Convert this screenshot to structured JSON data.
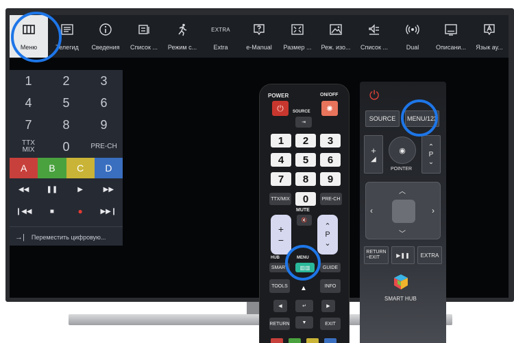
{
  "menu": {
    "items": [
      {
        "label": "Меню",
        "icon": "menu-grid-icon"
      },
      {
        "label": "Телегид",
        "icon": "guide-icon"
      },
      {
        "label": "Сведения",
        "icon": "info-icon"
      },
      {
        "label": "Список ...",
        "icon": "channel-list-icon"
      },
      {
        "label": "Режим с...",
        "icon": "sports-mode-icon"
      },
      {
        "label": "Extra",
        "icon": "extra-icon",
        "icon_text": "EXTRA"
      },
      {
        "label": "e-Manual",
        "icon": "emanual-icon"
      },
      {
        "label": "Размер ...",
        "icon": "picture-size-icon"
      },
      {
        "label": "Реж. изо...",
        "icon": "picture-mode-icon"
      },
      {
        "label": "Список ...",
        "icon": "sound-list-icon"
      },
      {
        "label": "Dual",
        "icon": "dual-icon"
      },
      {
        "label": "Описани...",
        "icon": "description-icon"
      },
      {
        "label": "Язык ау...",
        "icon": "audio-language-icon"
      }
    ]
  },
  "virtual_remote": {
    "numbers": [
      "1",
      "2",
      "3",
      "4",
      "5",
      "6",
      "7",
      "8",
      "9"
    ],
    "ttx": "TTX\nMIX",
    "zero": "0",
    "prech": "PRE-CH",
    "colors": [
      {
        "label": "A",
        "color": "#c8403b"
      },
      {
        "label": "B",
        "color": "#4aa23f"
      },
      {
        "label": "C",
        "color": "#c9b437"
      },
      {
        "label": "D",
        "color": "#3a6fc0"
      }
    ],
    "media_row1": [
      "◀◀",
      "❚❚",
      "▶",
      "▶▶"
    ],
    "media_row2": [
      "❙◀◀",
      "■",
      "●",
      "▶▶❙"
    ],
    "bottom_arrow": "→|",
    "bottom_text": "Переместить цифровую..."
  },
  "remote1": {
    "power": "POWER",
    "onoff": "ON/OFF",
    "source": "SOURCE",
    "digits": [
      "1",
      "2",
      "3",
      "4",
      "5",
      "6",
      "7",
      "8",
      "9",
      "0"
    ],
    "ttxmix": "TTX/MIX",
    "prech": "PRE-CH",
    "mute": "MUTE",
    "hub": "HUB",
    "menu": "MENU",
    "smart": "SMART",
    "guide": "GUIDE",
    "tools": "TOOLS",
    "info": "INFO",
    "return": "RETURN",
    "exit": "EXIT",
    "p": "P"
  },
  "remote2": {
    "source": "SOURCE",
    "menu": "MENU/123",
    "pointer": "POINTER",
    "p": "P",
    "return": "RETURN\n−EXIT",
    "playpause": "▶❚❚",
    "extra": "EXTRA",
    "smart_hub": "SMART HUB"
  },
  "colors": {
    "highlight_ring": "#1e76e8",
    "menu_bar_bg": "#1c1f24",
    "menu_selected_bg": "#e8e9eb",
    "tv_screen_bg": "#050608"
  }
}
